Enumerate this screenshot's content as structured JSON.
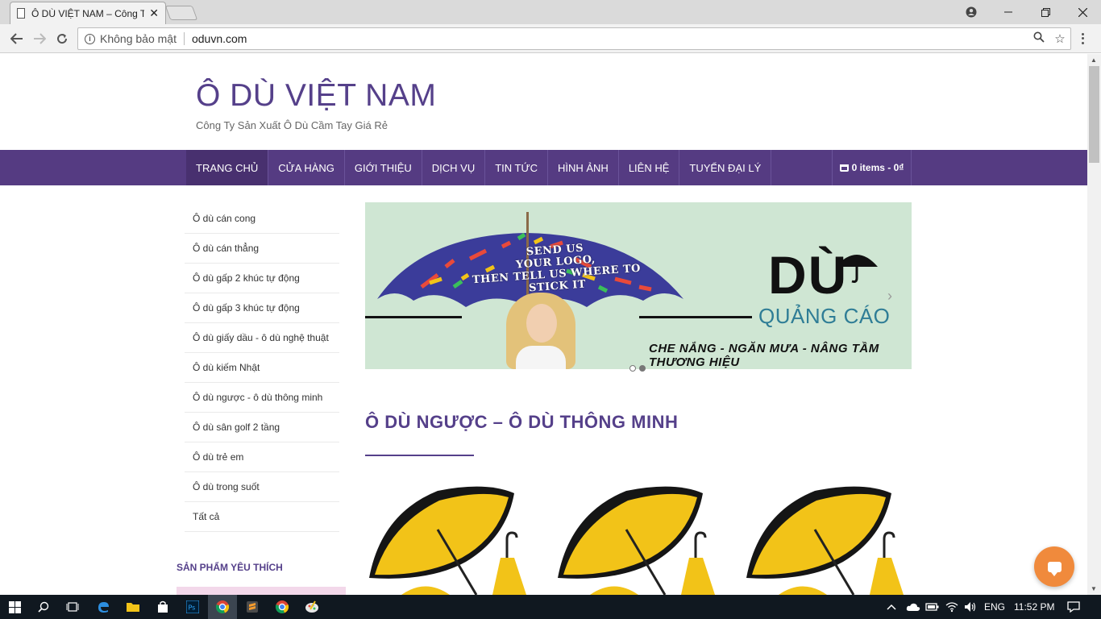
{
  "browser": {
    "tab_title": "Ô DÙ VIỆT NAM – Công Ty",
    "tab_close": "✕",
    "security_label": "Không bảo mật",
    "url": "oduvn.com"
  },
  "site": {
    "title": "Ô DÙ VIỆT NAM",
    "tagline": "Công Ty Sản Xuất Ô Dù Cầm Tay Giá Rẻ"
  },
  "nav": {
    "items": [
      {
        "label": "TRANG CHỦ"
      },
      {
        "label": "CỬA HÀNG"
      },
      {
        "label": "GIỚI THIỆU"
      },
      {
        "label": "DỊCH VỤ"
      },
      {
        "label": "TIN TỨC"
      },
      {
        "label": "HÌNH ẢNH"
      },
      {
        "label": "LIÊN HỆ"
      },
      {
        "label": "TUYỂN ĐẠI LÝ"
      }
    ],
    "cart_label": "0 items - 0₫"
  },
  "sidebar": {
    "categories": [
      {
        "label": "Ô dù cán cong"
      },
      {
        "label": "Ô dù cán thẳng"
      },
      {
        "label": "Ô dù gấp 2 khúc tự động"
      },
      {
        "label": "Ô dù gấp 3 khúc tự động"
      },
      {
        "label": "Ô dù giấy dầu - ô dù nghệ thuật"
      },
      {
        "label": "Ô dù kiếm Nhật"
      },
      {
        "label": "Ô dù ngược - ô dù thông minh"
      },
      {
        "label": "Ô dù sân golf 2 tầng"
      },
      {
        "label": "Ô dù trẻ em"
      },
      {
        "label": "Ô dù trong suốt"
      },
      {
        "label": "Tất cả"
      }
    ],
    "favorites_heading": "SẢN PHẨM YÊU THÍCH"
  },
  "banner": {
    "slogan_line1": "SEND US",
    "slogan_line2": "YOUR LOGO,",
    "slogan_line3": "THEN TELL US WHERE TO",
    "slogan_line4": "STICK IT",
    "brand_big": "DÙ",
    "brand_sub": "QUẢNG CÁO",
    "tagline": "CHE NẮNG - NGĂN MƯA - NÂNG TẦM THƯƠNG HIỆU"
  },
  "section": {
    "title": "Ô DÙ NGƯỢC – Ô DÙ THÔNG MINH"
  },
  "taskbar": {
    "language": "ENG",
    "time": "11:52 PM"
  },
  "colors": {
    "brand_purple": "#553b82",
    "umbrella_yellow": "#f2c318",
    "chat_orange": "#f08a3c"
  }
}
